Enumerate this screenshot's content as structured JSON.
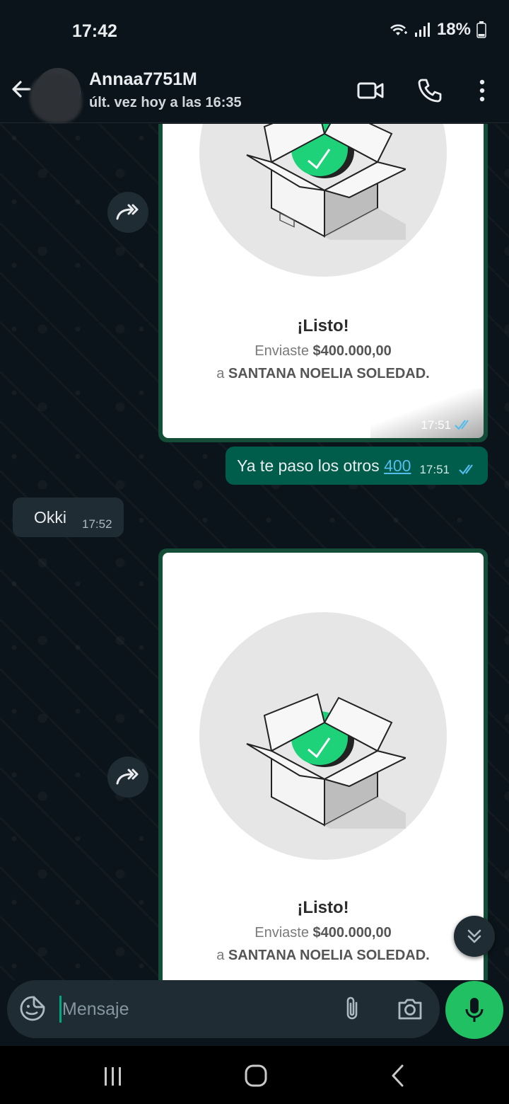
{
  "status_bar": {
    "time": "17:42",
    "battery": "18%",
    "icons": [
      "wifi-icon",
      "signal-icon",
      "battery-icon"
    ]
  },
  "header": {
    "contact_name": "Annaa7751M",
    "last_seen": "últ. vez hoy a las 16:35",
    "icons": [
      "back-arrow-icon",
      "video-call-icon",
      "phone-icon",
      "more-options-icon"
    ]
  },
  "messages": {
    "transfer_1": {
      "title": "¡Listo!",
      "sent_prefix": "Enviaste ",
      "amount": "$400.000,00",
      "recipient_prefix": "a ",
      "recipient": "SANTANA NOELIA SOLEDAD.",
      "time": "17:51"
    },
    "text_out": {
      "text": "Ya te paso los otros ",
      "link": "400",
      "time": "17:51"
    },
    "text_in": {
      "text": "Okki",
      "time": "17:52"
    },
    "transfer_2": {
      "title": "¡Listo!",
      "sent_prefix": "Enviaste ",
      "amount": "$400.000,00",
      "recipient_prefix": "a ",
      "recipient": "SANTANA NOELIA SOLEDAD."
    }
  },
  "input": {
    "placeholder": "Mensaje"
  },
  "colors": {
    "background": "#0b141a",
    "outgoing_bubble": "#005c4b",
    "incoming_bubble": "#202c33",
    "accent_green": "#21c063",
    "link_blue": "#53bdeb",
    "tick_blue": "#53bdeb"
  }
}
